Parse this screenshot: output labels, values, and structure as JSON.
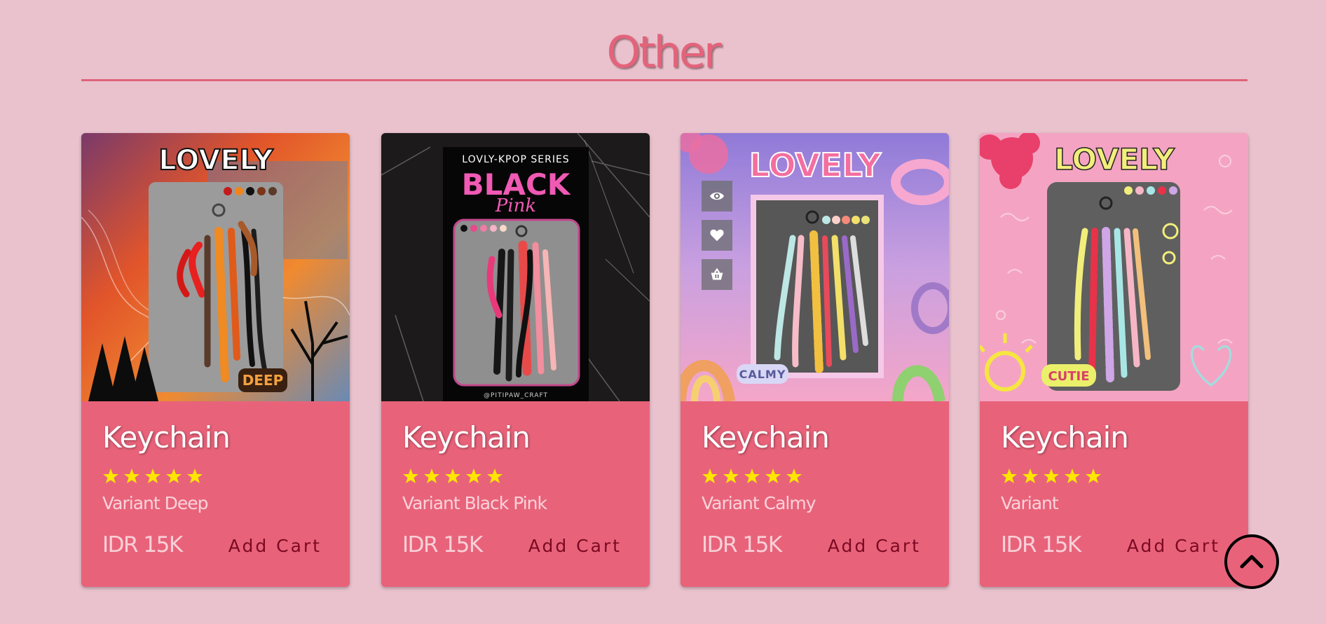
{
  "section": {
    "title": "Other"
  },
  "colors": {
    "background": "#e9c2cd",
    "card": "#e8637a",
    "accent": "#e4637b",
    "star": "#ffe600",
    "cart_text": "#7b0a22"
  },
  "cards": [
    {
      "image": {
        "brand": "LOVELY",
        "tag": "DEEP",
        "palette": [
          "#c41a1a",
          "#f0841a",
          "#111111",
          "#7a3418",
          "#5a3a28"
        ]
      },
      "name": "Keychain",
      "rating": 5,
      "variant": "Variant Deep",
      "price": "IDR 15K",
      "add_label": "Add Cart"
    },
    {
      "image": {
        "series": "LOVLY-KPOP SERIES",
        "brand": "BLACK",
        "script": "Pink",
        "credit": "@PITIPAW_CRAFT",
        "palette": [
          "#111111",
          "#e84a8a",
          "#f07ca6",
          "#f6b3c6",
          "#f8d8c8"
        ]
      },
      "name": "Keychain",
      "rating": 5,
      "variant": "Variant Black Pink",
      "price": "IDR 15K",
      "add_label": "Add Cart"
    },
    {
      "image": {
        "brand": "LOVELY",
        "tag": "CALMY",
        "palette": [
          "#bde7e4",
          "#fbd0c8",
          "#f48a7a",
          "#f2e06a",
          "#e8e27a"
        ]
      },
      "name": "Keychain",
      "rating": 5,
      "variant": "Variant Calmy",
      "price": "IDR 15K",
      "add_label": "Add Cart",
      "actions": [
        {
          "icon": "eye-icon"
        },
        {
          "icon": "heart-icon"
        },
        {
          "icon": "basket-icon"
        }
      ]
    },
    {
      "image": {
        "brand": "LOVELY",
        "tag": "CUTIE",
        "palette": [
          "#f2ee7c",
          "#f6b6c6",
          "#a8e6e6",
          "#e8324a",
          "#cfa6e6"
        ]
      },
      "name": "Keychain",
      "rating": 5,
      "variant": "Variant",
      "price": "IDR 15K",
      "add_label": "Add Cart"
    }
  ],
  "scroll_top": {
    "icon": "chevron-up-icon"
  }
}
